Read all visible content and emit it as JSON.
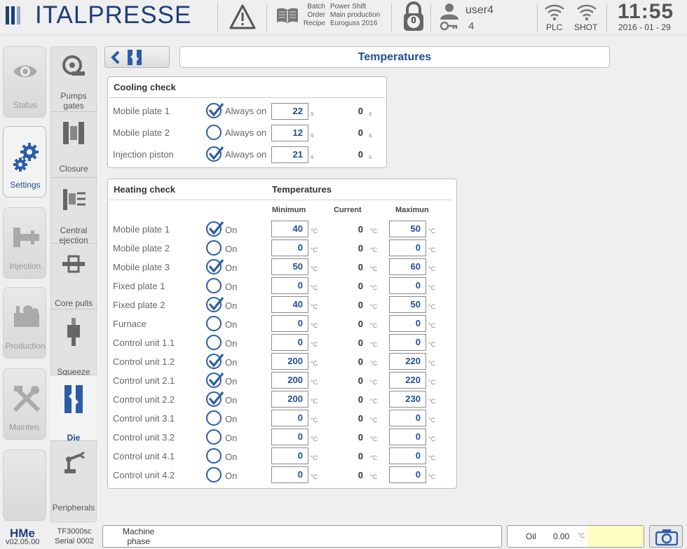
{
  "brand": {
    "name": "ITALPRESSE",
    "color": "#1d3f7a"
  },
  "header": {
    "batch_labels": [
      "Batch",
      "Order",
      "Recipe"
    ],
    "batch_values": [
      "Power Shift",
      "Main production",
      "Euroguss 2016"
    ],
    "lock_count": "0",
    "user_name": "user4",
    "user_level": "4",
    "plc_label": "PLC",
    "shot_label": "SHOT",
    "time": "11:55",
    "date": "2016 - 01 - 29"
  },
  "tabs": [
    {
      "label": "Status",
      "icon": "eye-icon"
    },
    {
      "label": "Settings",
      "icon": "gears-icon",
      "active": true
    },
    {
      "label": "Injection",
      "icon": "injection-icon"
    },
    {
      "label": "Production",
      "icon": "production-icon"
    },
    {
      "label": "Mainten.",
      "icon": "tools-icon"
    },
    {
      "label": "",
      "icon": ""
    }
  ],
  "subtabs": [
    {
      "label": "Pumps gates",
      "icon": "pump-icon"
    },
    {
      "label": "Closure",
      "icon": "closure-icon"
    },
    {
      "label": "Central ejection",
      "icon": "ejection-icon"
    },
    {
      "label": "Core pulls",
      "icon": "core-pulls-icon"
    },
    {
      "label": "Squeeze",
      "icon": "squeeze-icon"
    },
    {
      "label": "Die",
      "icon": "die-icon",
      "active": true
    },
    {
      "label": "Peripherals",
      "icon": "robot-arm-icon"
    }
  ],
  "page": {
    "title": "Temperatures"
  },
  "cooling": {
    "title": "Cooling check",
    "option_label": "Always on",
    "unit": "s",
    "rows": [
      {
        "label": "Mobile plate 1",
        "checked": true,
        "value": "22",
        "current": "0"
      },
      {
        "label": "Mobile plate 2",
        "checked": false,
        "value": "12",
        "current": "0"
      },
      {
        "label": "Injection piston",
        "checked": true,
        "value": "21",
        "current": "0"
      }
    ]
  },
  "heating": {
    "title": "Heating check",
    "group_title": "Temperatures",
    "col_min": "Minimum",
    "col_cur": "Current",
    "col_max": "Maximun",
    "option_label": "On",
    "unit": "°C",
    "rows": [
      {
        "label": "Mobile plate 1",
        "checked": true,
        "min": "40",
        "current": "0",
        "max": "50"
      },
      {
        "label": "Mobile plate 2",
        "checked": false,
        "min": "0",
        "current": "0",
        "max": "0"
      },
      {
        "label": "Mobile plate 3",
        "checked": true,
        "min": "50",
        "current": "0",
        "max": "60"
      },
      {
        "label": "Fixed plate 1",
        "checked": false,
        "min": "0",
        "current": "0",
        "max": "0"
      },
      {
        "label": "Fixed plate 2",
        "checked": true,
        "min": "40",
        "current": "0",
        "max": "50"
      },
      {
        "label": "Furnace",
        "checked": false,
        "min": "0",
        "current": "0",
        "max": "0"
      },
      {
        "label": "Control unit 1.1",
        "checked": false,
        "min": "0",
        "current": "0",
        "max": "0"
      },
      {
        "label": "Control unit 1.2",
        "checked": true,
        "min": "200",
        "current": "0",
        "max": "220"
      },
      {
        "label": "Control unit 2.1",
        "checked": true,
        "min": "200",
        "current": "0",
        "max": "220"
      },
      {
        "label": "Control unit 2.2",
        "checked": true,
        "min": "200",
        "current": "0",
        "max": "230"
      },
      {
        "label": "Control unit 3.1",
        "checked": false,
        "min": "0",
        "current": "0",
        "max": "0"
      },
      {
        "label": "Control unit 3.2",
        "checked": false,
        "min": "0",
        "current": "0",
        "max": "0"
      },
      {
        "label": "Control unit 4.1",
        "checked": false,
        "min": "0",
        "current": "0",
        "max": "0"
      },
      {
        "label": "Control unit 4.2",
        "checked": false,
        "min": "0",
        "current": "0",
        "max": "0"
      }
    ]
  },
  "footer": {
    "hme": "HMe",
    "version": "v02.05.00",
    "model": "TF3000sc",
    "serial": "Serial 0002",
    "machine_phase": "Machine\nphase",
    "oil_label": "Oil",
    "oil_value": "0.00",
    "oil_unit": "°C"
  },
  "colors": {
    "accent": "#1d4f91",
    "panel_border": "#bdbdbd",
    "oil_fill": "#fffdc0"
  }
}
